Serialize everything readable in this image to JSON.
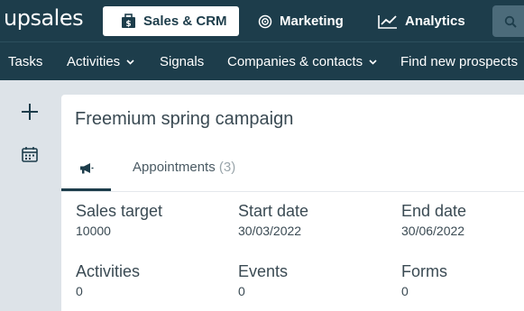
{
  "app": {
    "logo": "upsales"
  },
  "topnav": {
    "tabs": [
      {
        "label": "Sales & CRM",
        "icon": "briefcase-dollar-icon",
        "active": true
      },
      {
        "label": "Marketing",
        "icon": "target-icon",
        "active": false
      },
      {
        "label": "Analytics",
        "icon": "line-chart-icon",
        "active": false
      }
    ],
    "search_icon": "search-icon"
  },
  "subnav": {
    "items": [
      {
        "label": "Tasks",
        "dropdown": false
      },
      {
        "label": "Activities",
        "dropdown": true
      },
      {
        "label": "Signals",
        "dropdown": false
      },
      {
        "label": "Companies & contacts",
        "dropdown": true
      },
      {
        "label": "Find new prospects",
        "dropdown": false
      }
    ]
  },
  "sidebar": {
    "buttons": [
      {
        "icon": "plus-icon"
      },
      {
        "icon": "calendar-icon"
      }
    ]
  },
  "campaign": {
    "title": "Freemium spring campaign",
    "tabs": {
      "overview_icon": "megaphone-icon",
      "appointments_label": "Appointments",
      "appointments_count": "(3)"
    },
    "fields": [
      {
        "label": "Sales target",
        "value": "10000"
      },
      {
        "label": "Start date",
        "value": "30/03/2022"
      },
      {
        "label": "End date",
        "value": "30/06/2022"
      },
      {
        "label": "Activities",
        "value": "0"
      },
      {
        "label": "Events",
        "value": "0"
      },
      {
        "label": "Forms",
        "value": "0"
      }
    ]
  },
  "colors": {
    "header_bg": "#1d3d4b",
    "page_bg": "#dde3e8",
    "card_bg": "#ffffff",
    "text": "#3a4a53"
  }
}
